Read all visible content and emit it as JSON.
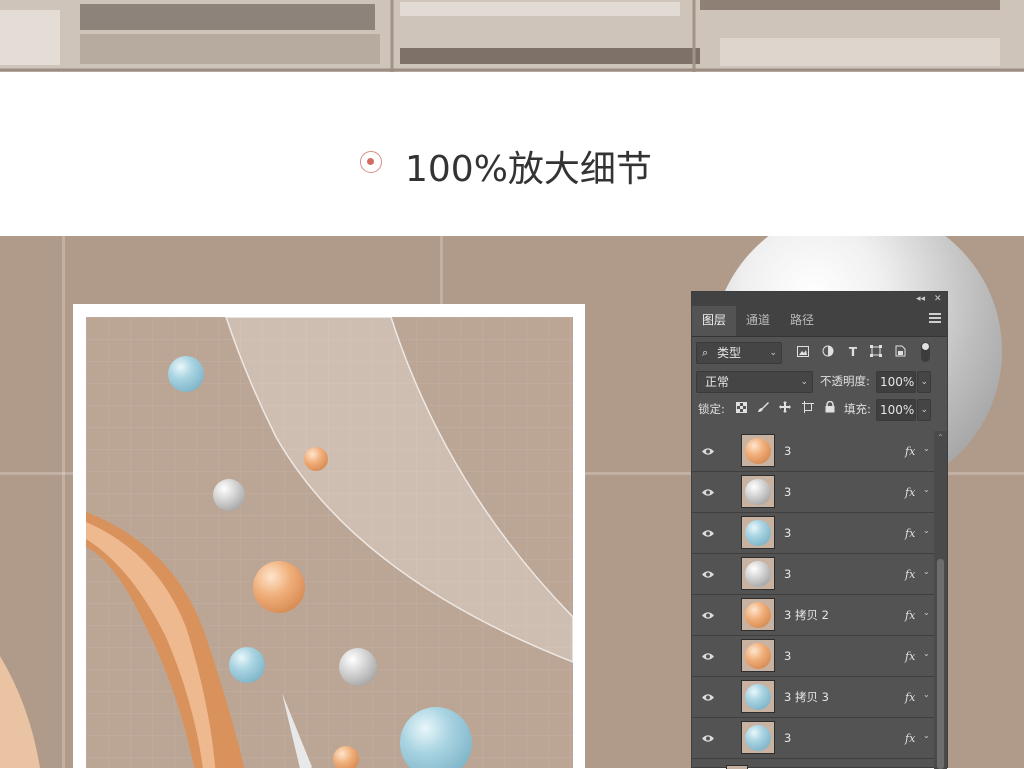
{
  "title": {
    "text": "100%放大细节",
    "icon": "target-circle-icon",
    "accent": "#d36b62"
  },
  "panel": {
    "tabs": [
      "图层",
      "通道",
      "路径"
    ],
    "active_tab": "图层",
    "filter": {
      "value": "类型",
      "icon": "search-icon"
    },
    "blend_mode": "正常",
    "opacity_label": "不透明度:",
    "opacity_value": "100%",
    "lock_label": "锁定:",
    "fill_label": "填充:",
    "fill_value": "100%",
    "fx_label": "fx",
    "layers": [
      {
        "name": "3",
        "thumb": "orange"
      },
      {
        "name": "3",
        "thumb": "grey"
      },
      {
        "name": "3",
        "thumb": "blue"
      },
      {
        "name": "3",
        "thumb": "grey"
      },
      {
        "name": "3 拷贝 2",
        "thumb": "orange"
      },
      {
        "name": "3",
        "thumb": "orange"
      },
      {
        "name": "3 拷贝 3",
        "thumb": "blue"
      },
      {
        "name": "3",
        "thumb": "blue"
      }
    ]
  },
  "colors": {
    "panel_bg": "#535353",
    "scene_bg": "#b09a8a",
    "blue_ball": "#a9d4e2",
    "orange_ball": "#f0ad78",
    "grey_ball": "#d2d2d2"
  }
}
